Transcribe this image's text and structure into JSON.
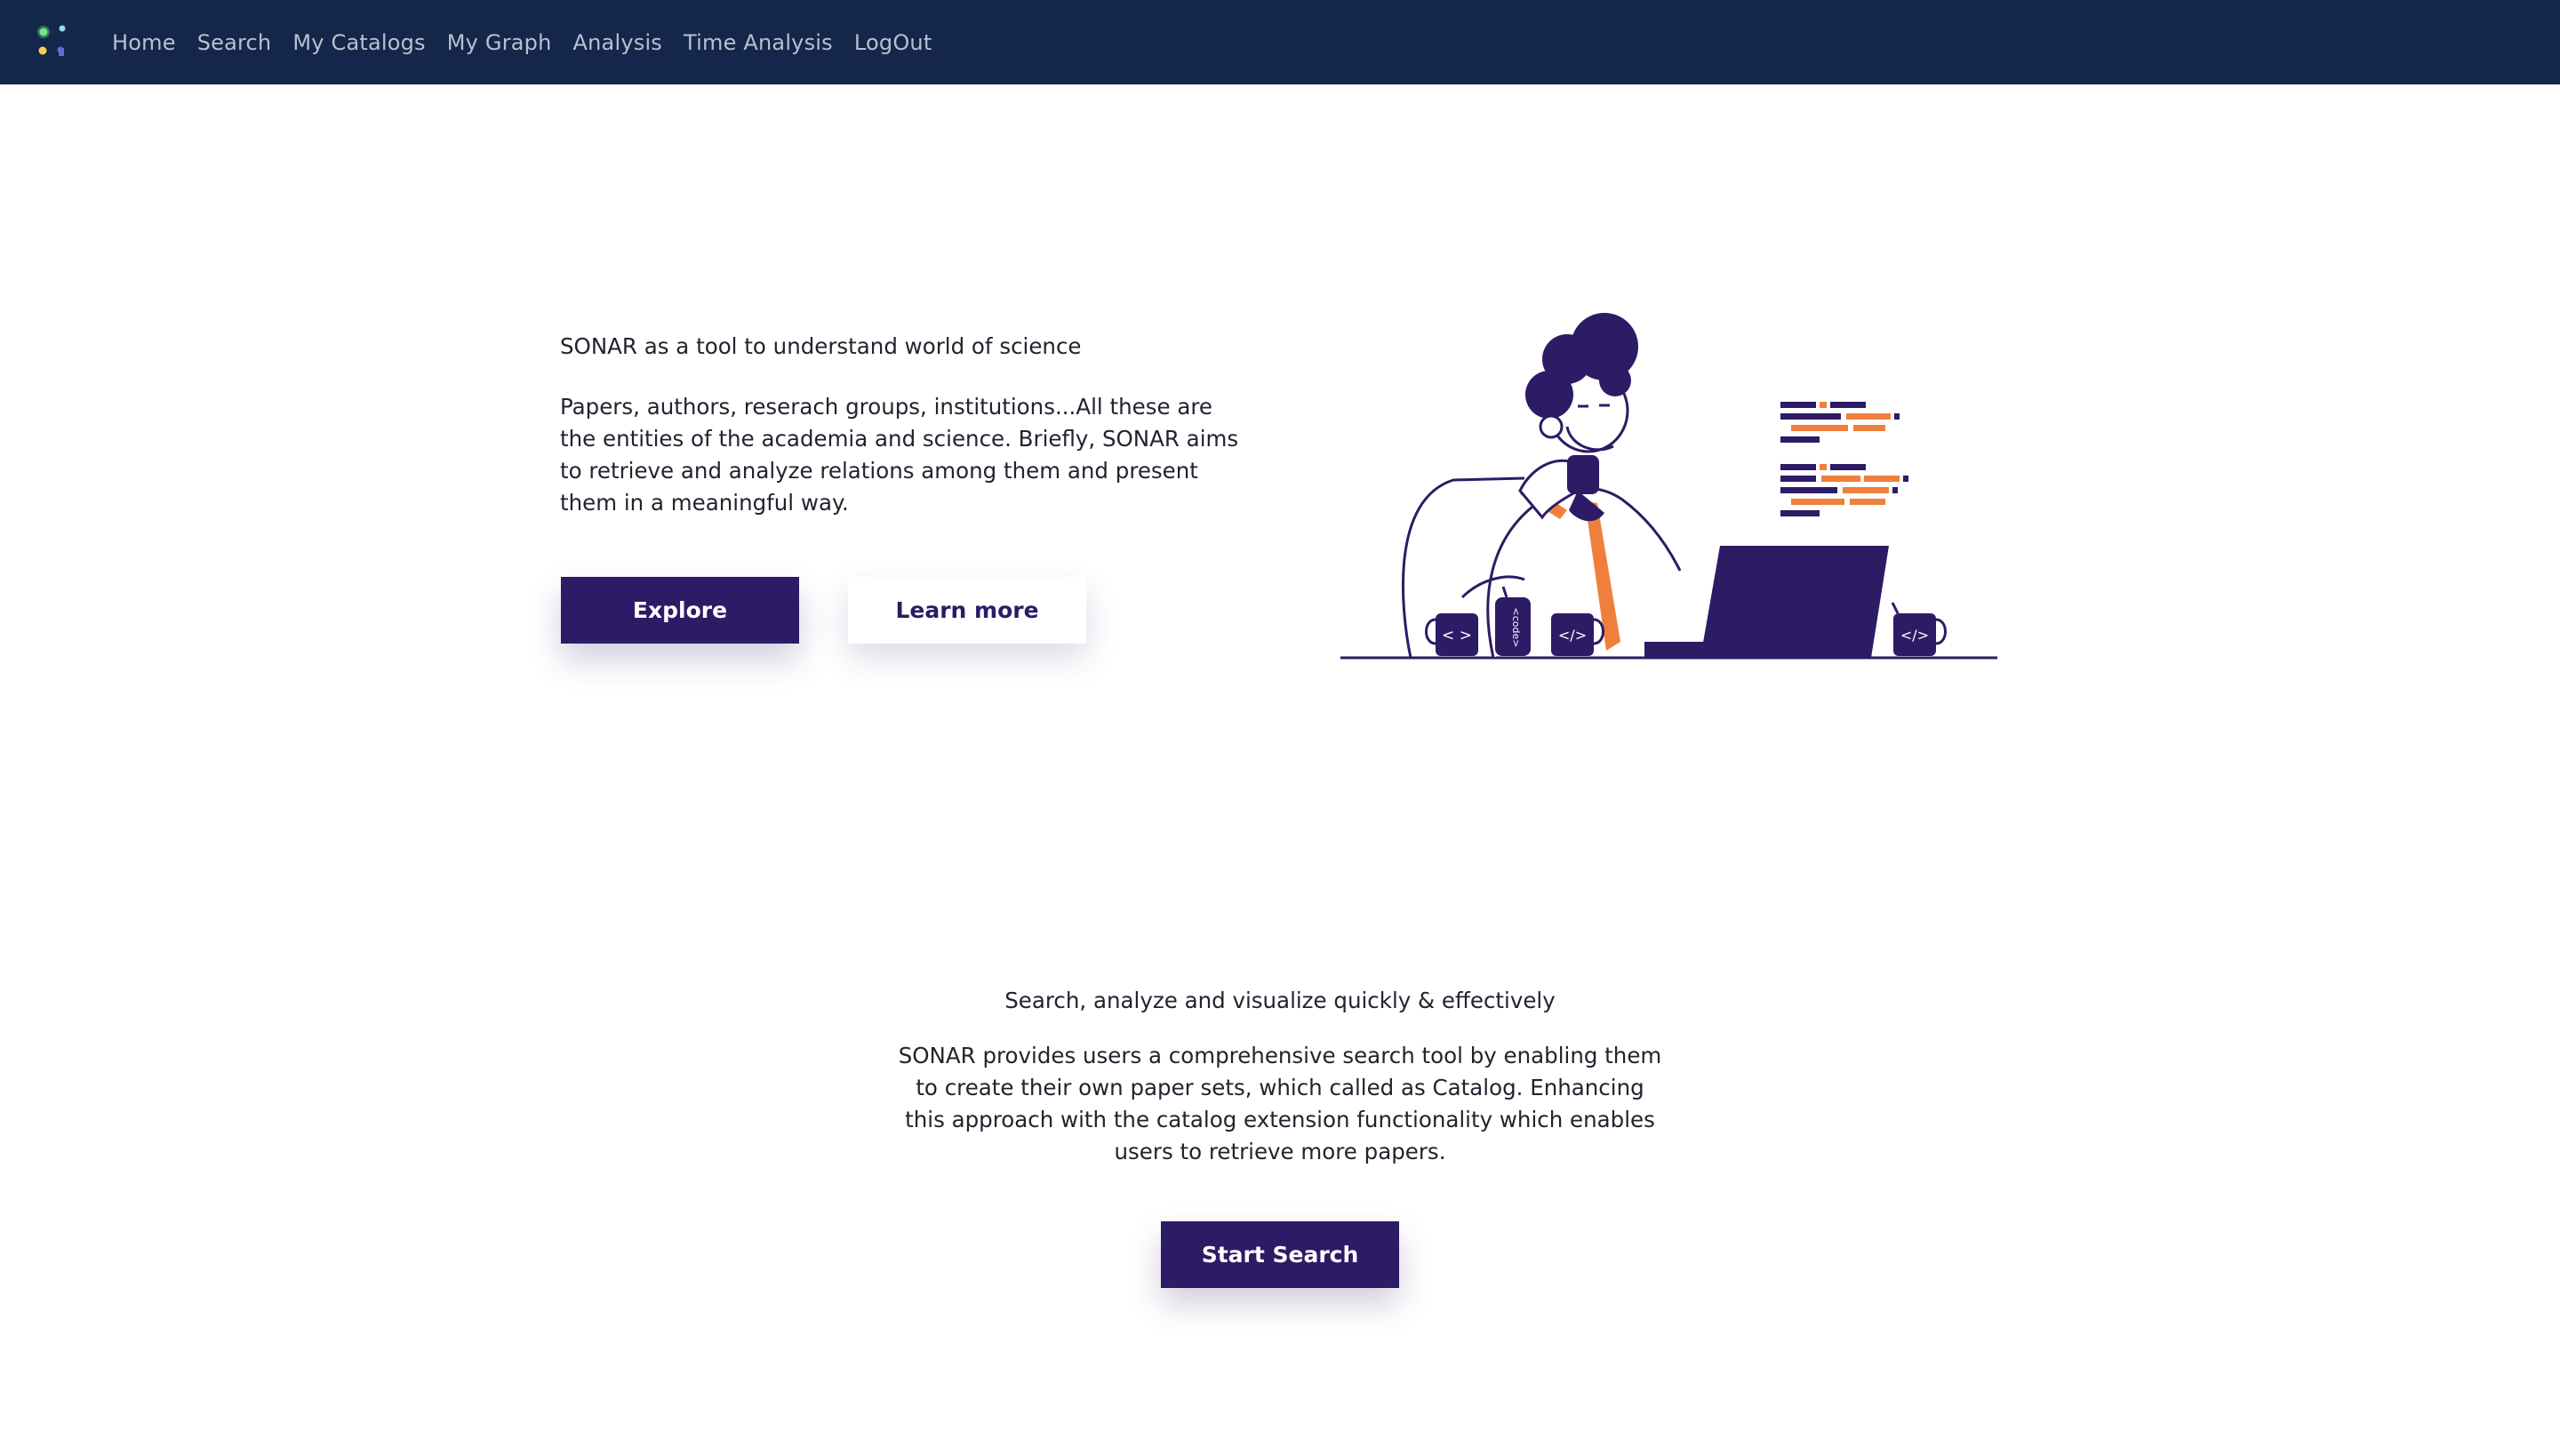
{
  "nav": {
    "logo_icon": "sonar-logo-icon",
    "links": [
      "Home",
      "Search",
      "My Catalogs",
      "My Graph",
      "Analysis",
      "Time Analysis",
      "LogOut"
    ]
  },
  "hero": {
    "title": "SONAR as a tool to understand world of science",
    "description": "Papers, authors, reserach groups, institutions...All these are the entities of the academia and science. Briefly, SONAR aims to retrieve and analyze relations among them and present them in a meaningful way.",
    "explore_label": "Explore",
    "learn_more_label": "Learn more",
    "illustration": "developer-at-laptop-illustration",
    "mug_labels": [
      "< >",
      "</>",
      "</>"
    ],
    "can_label": "<code>"
  },
  "search_section": {
    "title": "Search, analyze and visualize quickly & effectively",
    "description": "SONAR provides users a comprehensive search tool by enabling them to create their own paper sets, which called as Catalog. Enhancing this approach with the catalog extension functionality which enables users to retrieve more papers.",
    "start_search_label": "Start Search"
  },
  "colors": {
    "navbar": "#14274a",
    "primary": "#2d1b66",
    "accent": "#f07f3c",
    "nav_text": "#b9c0cf"
  }
}
